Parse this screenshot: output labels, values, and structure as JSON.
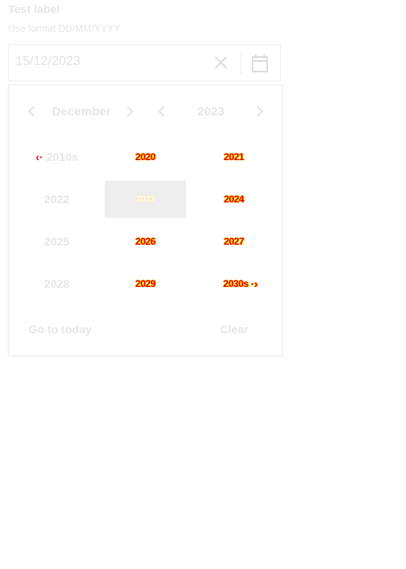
{
  "field": {
    "label": "Test label",
    "hint": "Use format DD/MM/YYYY",
    "value": "15/12/2023"
  },
  "header": {
    "month": "December",
    "year": "2023"
  },
  "years": {
    "rows": [
      [
        "2010s",
        "2020",
        "2021"
      ],
      [
        "2022",
        "2023",
        "2024"
      ],
      [
        "2025",
        "2026",
        "2027"
      ],
      [
        "2028",
        "2029",
        "2030s"
      ]
    ]
  },
  "footer": {
    "today_label": "Go to today",
    "clear_label": "Clear"
  },
  "icons": {
    "clear": "close-icon",
    "calendar": "calendar-icon",
    "prev": "chevron-left-icon",
    "next": "chevron-right-icon"
  },
  "colors": {
    "highlight_text": "#e20000",
    "highlight_outline": "#ffd400",
    "selected_bg": "#eeeeee"
  }
}
